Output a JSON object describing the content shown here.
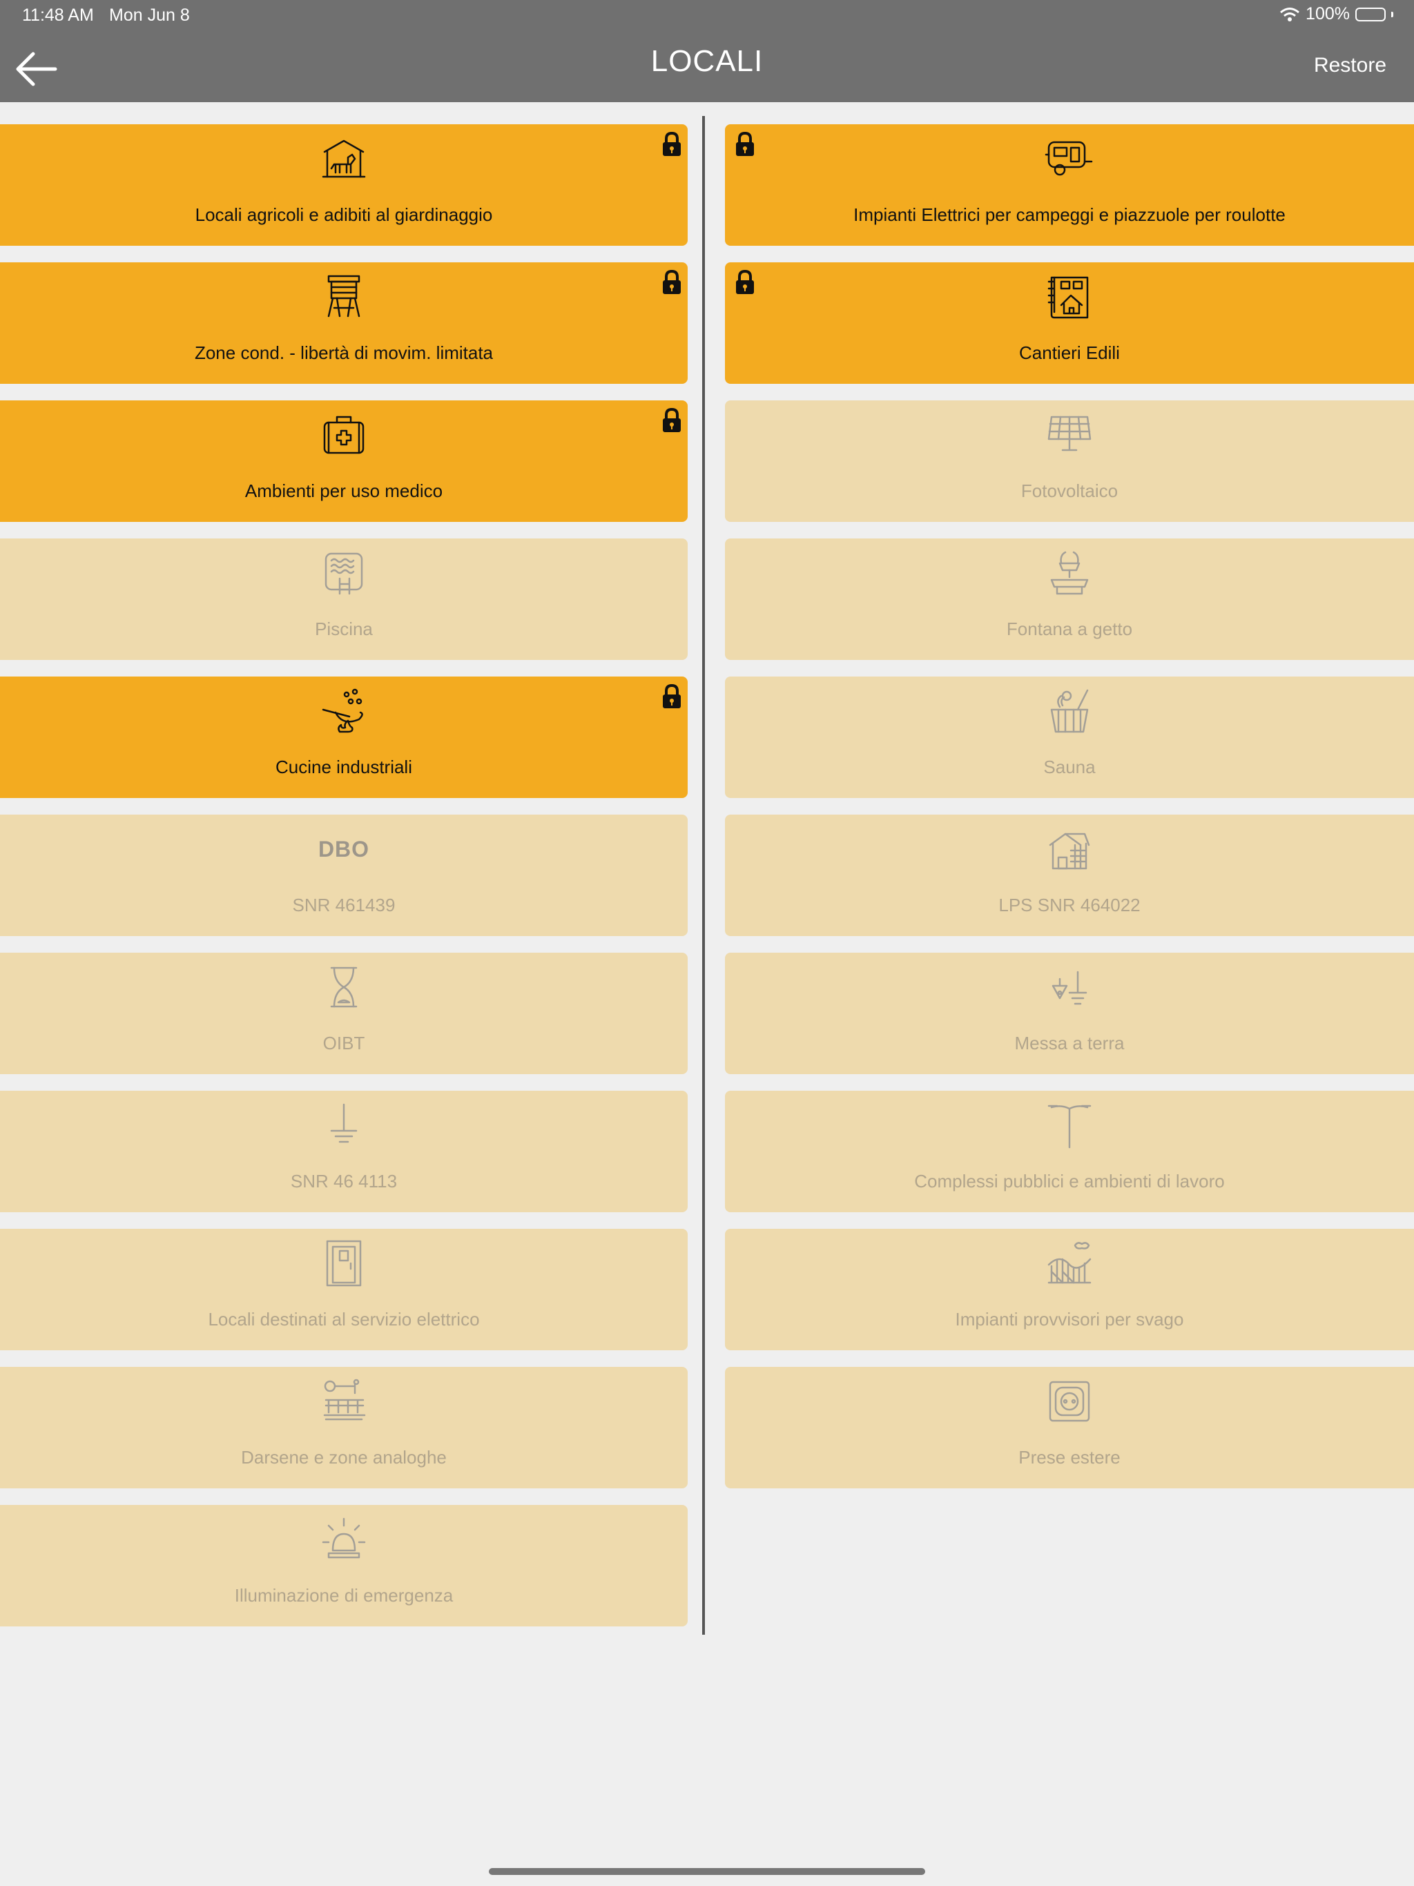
{
  "status_bar": {
    "time": "11:48 AM",
    "date": "Mon Jun 8",
    "battery": "100%"
  },
  "header": {
    "title": "LOCALI",
    "restore_label": "Restore",
    "back_icon": "arrow-left-icon"
  },
  "colors": {
    "header_bg": "#707070",
    "active_card": "#f3ab20",
    "inactive_card": "#eedaad",
    "background": "#efefef"
  },
  "left_items": [
    {
      "label": "Locali agricoli e adibiti al giardinaggio",
      "icon": "barn-horse-icon",
      "active": true,
      "locked": true
    },
    {
      "label": "Zone cond. - libertà di movim. limitata",
      "icon": "watchtower-icon",
      "active": true,
      "locked": true
    },
    {
      "label": "Ambienti per uso medico",
      "icon": "medical-bag-icon",
      "active": true,
      "locked": true
    },
    {
      "label": "Piscina",
      "icon": "pool-icon",
      "active": false,
      "locked": false
    },
    {
      "label": "Cucine industriali",
      "icon": "wok-fire-icon",
      "active": true,
      "locked": true
    },
    {
      "label": "SNR 461439",
      "icon": "dbo-text-icon",
      "icon_text": "DBO",
      "active": false,
      "locked": false
    },
    {
      "label": "OIBT",
      "icon": "hourglass-icon",
      "active": false,
      "locked": false
    },
    {
      "label": "SNR 46 4113",
      "icon": "ground-symbol-icon",
      "active": false,
      "locked": false
    },
    {
      "label": "Locali destinati al servizio elettrico",
      "icon": "door-icon",
      "active": false,
      "locked": false
    },
    {
      "label": "Darsene e zone analoghe",
      "icon": "dock-icon",
      "active": false,
      "locked": false
    },
    {
      "label": "Illuminazione di emergenza",
      "icon": "emergency-light-icon",
      "active": false,
      "locked": false
    }
  ],
  "right_items": [
    {
      "label": "Impianti Elettrici per campeggi e piazzuole per roulotte",
      "icon": "caravan-icon",
      "active": true,
      "locked": true
    },
    {
      "label": "Cantieri Edili",
      "icon": "blueprint-house-icon",
      "active": true,
      "locked": true
    },
    {
      "label": "Fotovoltaico",
      "icon": "solar-panel-icon",
      "active": false,
      "locked": false
    },
    {
      "label": "Fontana a getto",
      "icon": "fountain-icon",
      "active": false,
      "locked": false
    },
    {
      "label": "Sauna",
      "icon": "sauna-bucket-icon",
      "active": false,
      "locked": false
    },
    {
      "label": "LPS SNR 464022",
      "icon": "building-icon",
      "active": false,
      "locked": false
    },
    {
      "label": "Messa a terra",
      "icon": "earthing-icon",
      "active": false,
      "locked": false
    },
    {
      "label": "Complessi pubblici e ambienti di lavoro",
      "icon": "street-lamp-icon",
      "active": false,
      "locked": false
    },
    {
      "label": "Impianti provvisori per svago",
      "icon": "rollercoaster-icon",
      "active": false,
      "locked": false
    },
    {
      "label": "Prese estere",
      "icon": "socket-icon",
      "active": false,
      "locked": false
    }
  ]
}
